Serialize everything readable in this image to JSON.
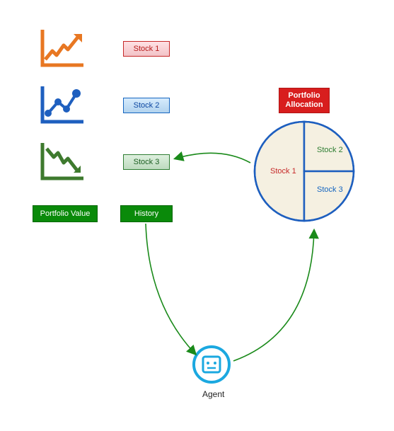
{
  "stocks": {
    "s1": {
      "label": "Stock 1"
    },
    "s2": {
      "label": "Stock 2"
    },
    "s3": {
      "label": "Stock 3"
    }
  },
  "badges": {
    "portfolio_value": "Portfolio Value",
    "history": "History",
    "portfolio_allocation": "Portfolio\nAllocation"
  },
  "agent": {
    "label": "Agent"
  },
  "pie": {
    "slices": {
      "s1": {
        "label": "Stock 1"
      },
      "s2": {
        "label": "Stock 2"
      },
      "s3": {
        "label": "Stock 3"
      }
    }
  },
  "colors": {
    "orange": "#e87722",
    "blue": "#1e5fbf",
    "green_dark": "#3e7a2e",
    "arrow_green": "#1a8a1a"
  },
  "chart_data": {
    "type": "pie",
    "title": "Portfolio Allocation",
    "series": [
      {
        "name": "Stock 1",
        "value": 50
      },
      {
        "name": "Stock 2",
        "value": 25
      },
      {
        "name": "Stock 3",
        "value": 25
      }
    ]
  }
}
